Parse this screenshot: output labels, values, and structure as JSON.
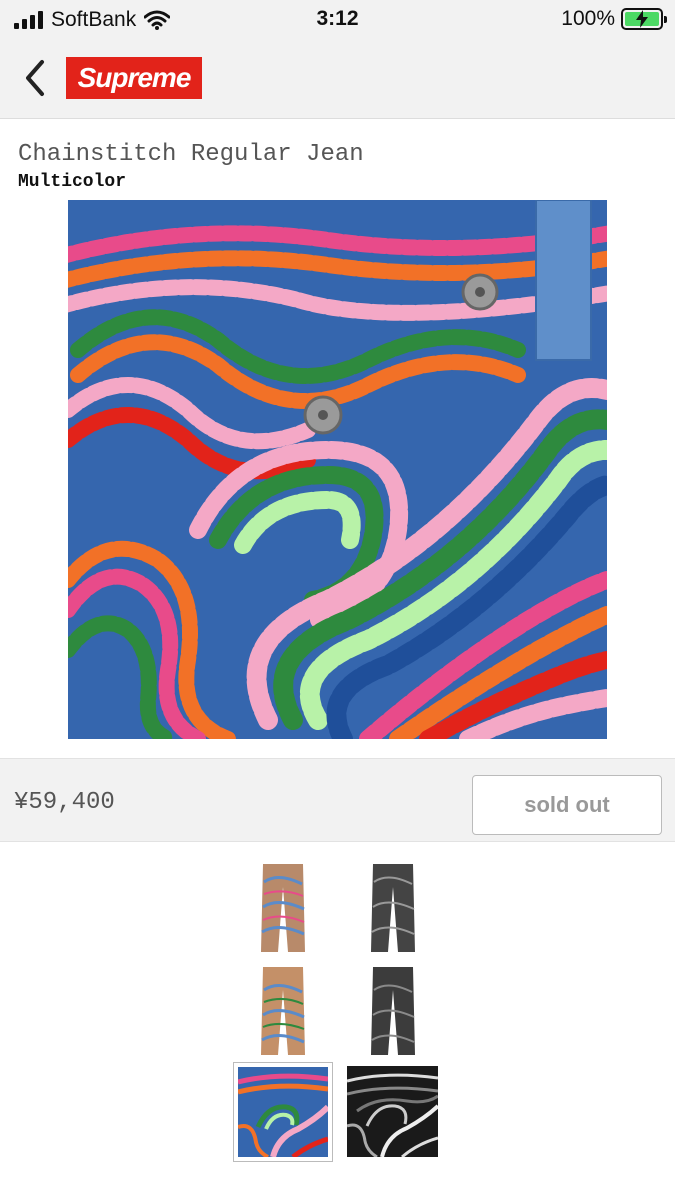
{
  "status_bar": {
    "carrier": "SoftBank",
    "time": "3:12",
    "battery": "100%",
    "battery_level": 1.0
  },
  "header": {
    "brand": "Supreme",
    "brand_color": "#e2231a"
  },
  "product": {
    "name": "Chainstitch Regular Jean",
    "color": "Multicolor",
    "price": "¥59,400",
    "status": "sold out"
  },
  "icons": {
    "back": "chevron-left-icon",
    "wifi": "wifi-icon",
    "signal": "signal-icon",
    "battery": "battery-charging-icon"
  },
  "colors": {
    "background": "#ffffff",
    "bar": "#f2f2f2",
    "battery_fill": "#4cd964"
  }
}
